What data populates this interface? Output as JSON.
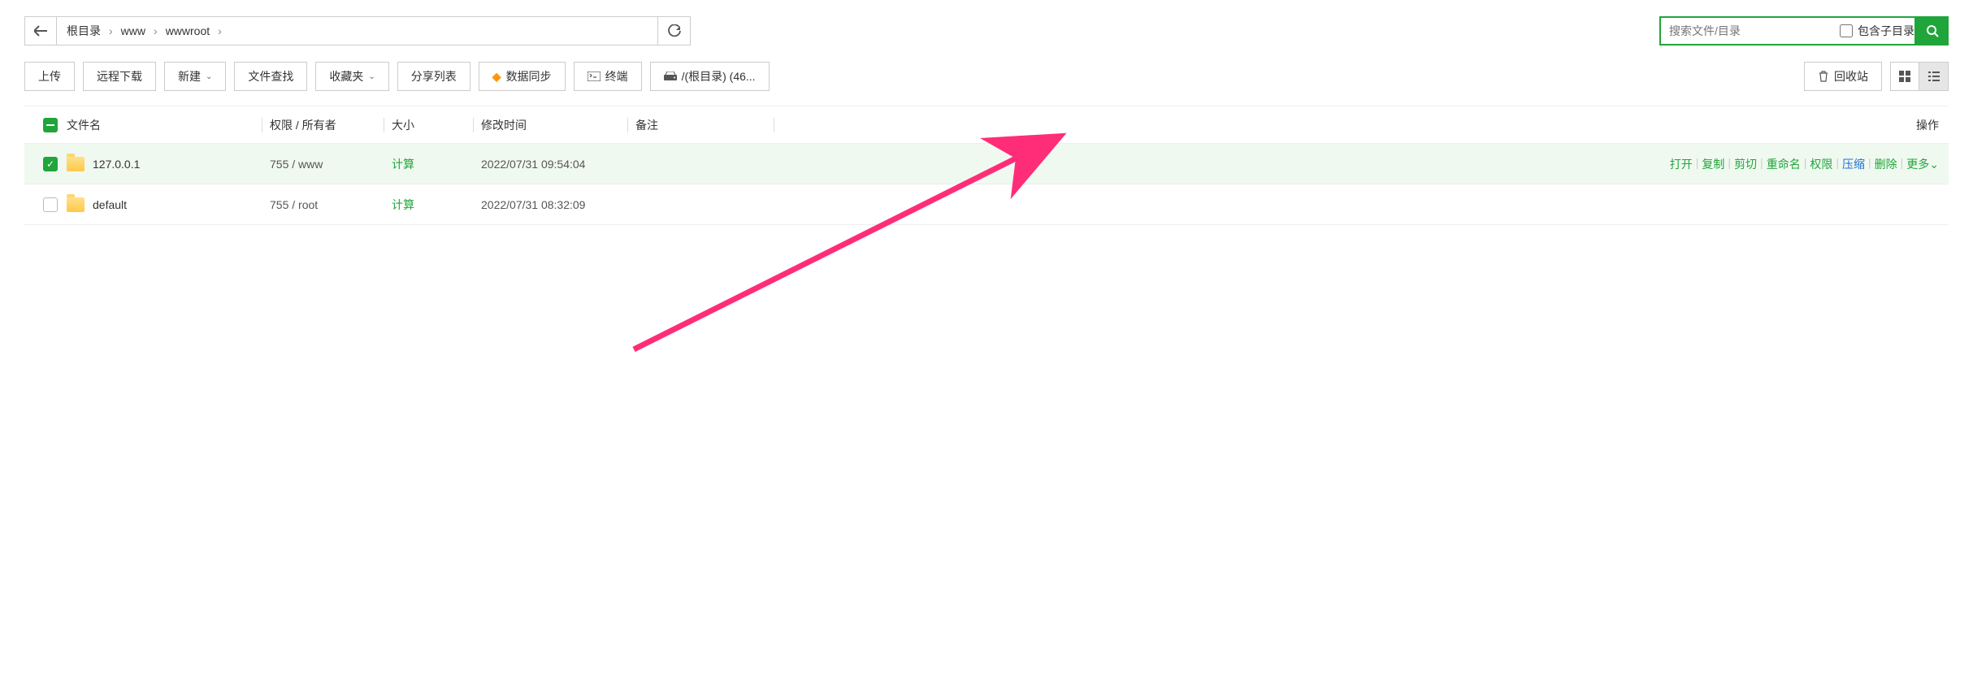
{
  "breadcrumbs": {
    "items": [
      "根目录",
      "www",
      "wwwroot"
    ]
  },
  "search": {
    "placeholder": "搜索文件/目录",
    "subdir_label": "包含子目录"
  },
  "toolbar": {
    "upload": "上传",
    "remote_download": "远程下载",
    "new_menu": "新建",
    "file_search": "文件查找",
    "favorites": "收藏夹",
    "share_list": "分享列表",
    "data_sync": "数据同步",
    "terminal": "终端",
    "disk_info": "/(根目录) (46...",
    "recycle_bin": "回收站"
  },
  "columns": {
    "name": "文件名",
    "perm": "权限 / 所有者",
    "size": "大小",
    "mtime": "修改时间",
    "note": "备注",
    "actions": "操作"
  },
  "size_calc_label": "计算",
  "rows": [
    {
      "name": "127.0.0.1",
      "perm": "755 / www",
      "mtime": "2022/07/31 09:54:04",
      "checked": true
    },
    {
      "name": "default",
      "perm": "755 / root",
      "mtime": "2022/07/31 08:32:09",
      "checked": false
    }
  ],
  "row_actions": {
    "open": "打开",
    "copy": "复制",
    "cut": "剪切",
    "rename": "重命名",
    "perm": "权限",
    "compress": "压缩",
    "delete": "删除",
    "more": "更多"
  }
}
